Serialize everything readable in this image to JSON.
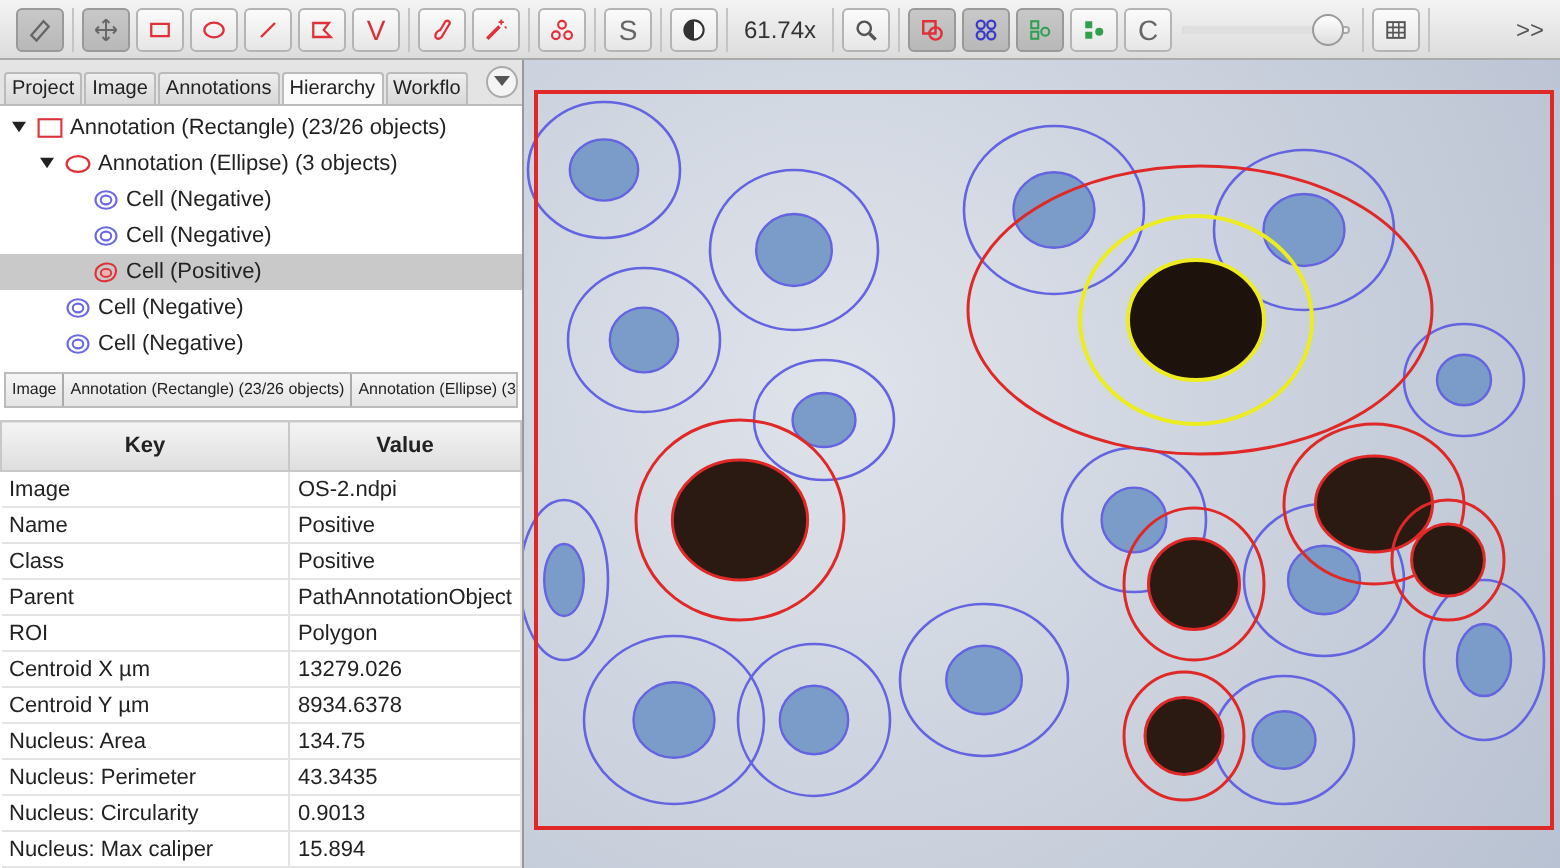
{
  "toolbar": {
    "groups": [
      [
        {
          "kind": "ruler",
          "selected": true
        }
      ],
      [
        {
          "kind": "move",
          "selected": true
        },
        {
          "kind": "rectangle",
          "selected": false
        },
        {
          "kind": "ellipse",
          "selected": false
        },
        {
          "kind": "line",
          "selected": false
        },
        {
          "kind": "polygon",
          "selected": false
        },
        {
          "kind": "text",
          "label": "V",
          "selected": false
        }
      ],
      [
        {
          "kind": "brush",
          "selected": false
        },
        {
          "kind": "wand",
          "selected": false
        }
      ],
      [
        {
          "kind": "points",
          "selected": false
        }
      ],
      [
        {
          "kind": "text",
          "label": "S",
          "selected": false
        }
      ],
      [
        {
          "kind": "contrast",
          "selected": false
        }
      ],
      [
        {
          "kind": "readout",
          "label": "61.74x"
        }
      ],
      [
        {
          "kind": "zoom",
          "selected": false
        }
      ],
      [
        {
          "kind": "annotations",
          "selected": true
        },
        {
          "kind": "grid-cores",
          "selected": true
        },
        {
          "kind": "detections",
          "selected": true
        },
        {
          "kind": "fill",
          "selected": false
        },
        {
          "kind": "text",
          "label": "C",
          "selected": false
        },
        {
          "kind": "slider",
          "level": 0.95
        }
      ],
      [
        {
          "kind": "table",
          "selected": false
        }
      ],
      [
        {
          "kind": "overflow",
          "label": ">>"
        }
      ]
    ]
  },
  "tabs": [
    {
      "label": "Project",
      "selected": false
    },
    {
      "label": "Image",
      "selected": false
    },
    {
      "label": "Annotations",
      "selected": false
    },
    {
      "label": "Hierarchy",
      "selected": true
    },
    {
      "label": "Workflo",
      "selected": false
    }
  ],
  "tree": [
    {
      "kind": "rectangle",
      "label": "Annotation (Rectangle) (23/26 objects)",
      "expanded": true,
      "selected": false,
      "children": [
        {
          "kind": "ellipse",
          "label": "Annotation (Ellipse) (3 objects)",
          "expanded": true,
          "selected": false,
          "children": [
            {
              "kind": "negative",
              "label": "Cell (Negative)",
              "selected": false
            },
            {
              "kind": "negative",
              "label": "Cell (Negative)",
              "selected": false
            },
            {
              "kind": "positive",
              "label": "Cell (Positive)",
              "selected": true
            }
          ]
        },
        {
          "kind": "negative",
          "label": "Cell (Negative)",
          "selected": false
        },
        {
          "kind": "negative",
          "label": "Cell (Negative)",
          "selected": false
        }
      ]
    }
  ],
  "breadcrumb": [
    "Image",
    "Annotation (Rectangle) (23/26 objects)",
    "Annotation (Ellipse) (3"
  ],
  "table": {
    "columns": [
      "Key",
      "Value"
    ],
    "rows": [
      [
        "Image",
        "OS-2.ndpi"
      ],
      [
        "Name",
        "Positive"
      ],
      [
        "Class",
        "Positive"
      ],
      [
        "Parent",
        "PathAnnotationObject"
      ],
      [
        "ROI",
        "Polygon"
      ],
      [
        "Centroid X µm",
        "13279.026"
      ],
      [
        "Centroid Y µm",
        "8934.6378"
      ],
      [
        "Nucleus: Area",
        "134.75"
      ],
      [
        "Nucleus: Perimeter",
        "43.3435"
      ],
      [
        "Nucleus: Circularity",
        "0.9013"
      ],
      [
        "Nucleus: Max caliper",
        "15.894"
      ]
    ]
  }
}
